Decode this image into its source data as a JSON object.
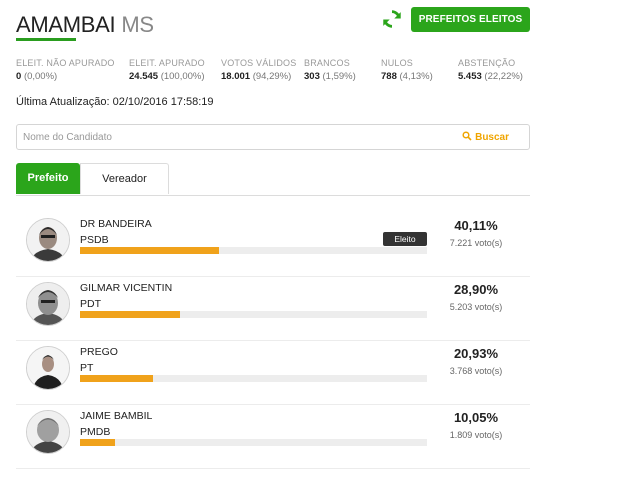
{
  "header": {
    "city": "AMAMBAI",
    "state": "MS",
    "accent_color": "#2ba51b",
    "refresh_icon": "refresh-icon",
    "eleitos_button": "PREFEITOS ELEITOS"
  },
  "stats": [
    {
      "label": "ELEIT. NÃO APURADO",
      "value": "0",
      "pct": "(0,00%)"
    },
    {
      "label": "ELEIT. APURADO",
      "value": "24.545",
      "pct": "(100,00%)"
    },
    {
      "label": "VOTOS VÁLIDOS",
      "value": "18.001",
      "pct": "(94,29%)"
    },
    {
      "label": "BRANCOS",
      "value": "303",
      "pct": "(1,59%)"
    },
    {
      "label": "NULOS",
      "value": "788",
      "pct": "(4,13%)"
    },
    {
      "label": "ABSTENÇÃO",
      "value": "5.453",
      "pct": "(22,22%)"
    }
  ],
  "update": {
    "label": "Última Atualização:",
    "value": "02/10/2016 17:58:19"
  },
  "search": {
    "placeholder": "Nome do Candidato",
    "button": "Buscar",
    "icon": "search-icon"
  },
  "tabs": [
    {
      "label": "Prefeito",
      "active": true
    },
    {
      "label": "Vereador",
      "active": false
    }
  ],
  "candidates": [
    {
      "name": "DR BANDEIRA",
      "party": "PSDB",
      "percent": "40,11%",
      "votes": "7.221 voto(s)",
      "bar_fraction": 0.4011,
      "badge": "Eleito"
    },
    {
      "name": "GILMAR VICENTIN",
      "party": "PDT",
      "percent": "28,90%",
      "votes": "5.203 voto(s)",
      "bar_fraction": 0.289
    },
    {
      "name": "PREGO",
      "party": "PT",
      "percent": "20,93%",
      "votes": "3.768 voto(s)",
      "bar_fraction": 0.2093
    },
    {
      "name": "JAIME BAMBIL",
      "party": "PMDB",
      "percent": "10,05%",
      "votes": "1.809 voto(s)",
      "bar_fraction": 0.1005
    }
  ]
}
